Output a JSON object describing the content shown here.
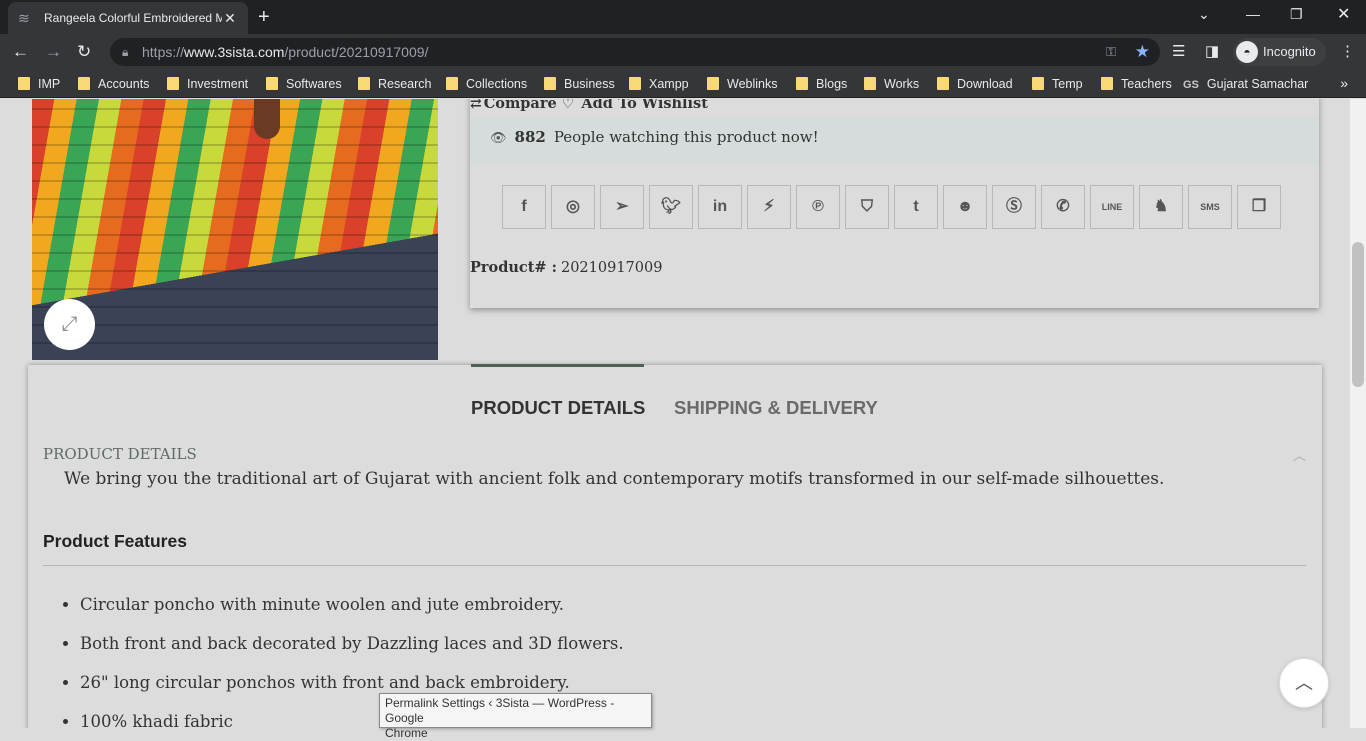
{
  "browser": {
    "tab_title": "Rangeela Colorful Embroidered M",
    "url_prefix": "https://",
    "url_domain": "www.3sista.com",
    "url_path": "/product/20210917009/",
    "profile_label": "Incognito"
  },
  "bookmarks": [
    {
      "label": "IMP"
    },
    {
      "label": "Accounts"
    },
    {
      "label": "Investment"
    },
    {
      "label": "Softwares"
    },
    {
      "label": "Research"
    },
    {
      "label": "Collections"
    },
    {
      "label": "Business"
    },
    {
      "label": "Xampp"
    },
    {
      "label": "Weblinks"
    },
    {
      "label": "Blogs"
    },
    {
      "label": "Works"
    },
    {
      "label": "Download"
    },
    {
      "label": "Temp"
    },
    {
      "label": "Teachers"
    },
    {
      "label": "Gujarat Samachar",
      "icon_text": "GS"
    }
  ],
  "product": {
    "compare_label": "Compare",
    "wishlist_label": "Add To Wishlist",
    "watch_count": "882",
    "watch_text": "People watching this product now!",
    "product_num_label": "Product# :",
    "product_num_value": "20210917009",
    "share_icons": [
      "facebook-icon",
      "whatsapp-icon",
      "telegram-icon",
      "twitter-icon",
      "linkedin-icon",
      "messenger-icon",
      "pinterest-icon",
      "pocket-icon",
      "tumblr-icon",
      "reddit-icon",
      "skype-icon",
      "viber-icon",
      "line-icon",
      "evernote-icon",
      "sms-icon",
      "copy-icon"
    ],
    "share_line_text": "LINE",
    "share_sms_text": "SMS"
  },
  "details": {
    "tab_active": "PRODUCT DETAILS",
    "tab_inactive": "SHIPPING & DELIVERY",
    "section_title": "PRODUCT DETAILS",
    "intro": "We bring you the traditional art of Gujarat with ancient folk and contemporary motifs transformed in our self-made silhouettes.",
    "features_heading": "Product Features",
    "features": [
      "Circular poncho with minute woolen and jute embroidery.",
      "Both front and back decorated by Dazzling laces and 3D flowers.",
      "26\" long circular ponchos with front and back embroidery.",
      "100% khadi fabric"
    ]
  },
  "tooltip": {
    "line1": "Permalink Settings ‹ 3Sista — WordPress - Google",
    "line2": "Chrome"
  },
  "colors": {
    "accent": "#4f5f52",
    "bookmark_folder": "#f9d976",
    "star": "#8ab4f8"
  }
}
